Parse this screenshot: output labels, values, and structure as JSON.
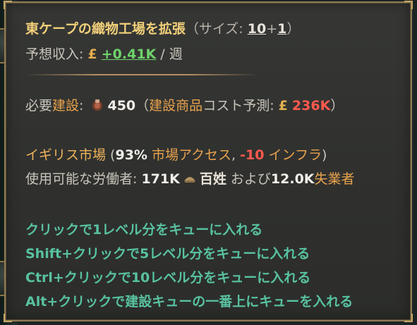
{
  "title": {
    "main": "東ケープの織物工場を拡張",
    "sub_prefix": "（サイズ: ",
    "size": "10",
    "plus": "+",
    "increment": "1",
    "sub_suffix": "）"
  },
  "income": {
    "label": "予想収入: ",
    "currency": "£",
    "value": "+0.41K",
    "per": " / 週"
  },
  "requirement": {
    "label_prefix": "必要",
    "label_keyword": "建設",
    "label_suffix": ": ",
    "amount": "450",
    "paren_open": "（",
    "goods_keyword": "建設商品",
    "cost_text": "コスト予測: ",
    "currency": "£",
    "cost_value": "236K",
    "paren_close": "）"
  },
  "market": {
    "name": "イギリス市場",
    "open": " (",
    "access_value": "93%",
    "access_label": " 市場アクセス",
    "comma": ", ",
    "infra_value": "-10",
    "infra_label": " インフラ",
    "close": ")"
  },
  "workers": {
    "label": "使用可能な労働者: ",
    "count": "171K",
    "group": "百姓",
    "and": " および",
    "unemployed_count": "12.0K",
    "unemployed_label": "失業者"
  },
  "hints": [
    "クリックで1レベル分をキューに入れる",
    "Shift+クリックで5レベル分をキューに入れる",
    "Ctrl+クリックで10レベル分をキューに入れる",
    "Alt+クリックで建設キューの一番上にキューを入れる"
  ],
  "icons": {
    "construction": "construction-icon",
    "peasants": "peasants-icon"
  }
}
